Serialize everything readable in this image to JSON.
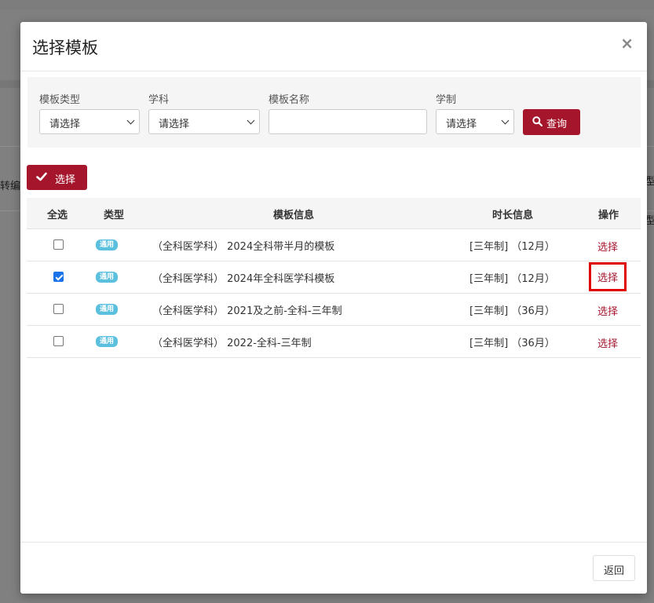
{
  "modal": {
    "title": "选择模板",
    "close_icon": "×"
  },
  "filters": {
    "template_type": {
      "label": "模板类型",
      "value": "请选择"
    },
    "subject": {
      "label": "学科",
      "value": "请选择"
    },
    "template_name": {
      "label": "模板名称",
      "value": ""
    },
    "system": {
      "label": "学制",
      "value": "请选择"
    },
    "query_button": {
      "label": "查询",
      "icon": "search-icon"
    }
  },
  "toolbar": {
    "select_button": {
      "label": "选择",
      "icon": "check-icon"
    }
  },
  "table": {
    "headers": [
      "全选",
      "类型",
      "模板信息",
      "时长信息",
      "操作"
    ],
    "rows": [
      {
        "checked": false,
        "type": "通用",
        "info": "（全科医学科） 2024全科带半月的模板",
        "duration": "[三年制] （12月）",
        "action": "选择"
      },
      {
        "checked": true,
        "type": "通用",
        "info": "（全科医学科） 2024年全科医学科模板",
        "duration": "[三年制] （12月）",
        "action": "选择"
      },
      {
        "checked": false,
        "type": "通用",
        "info": "（全科医学科） 2021及之前-全科-三年制",
        "duration": "[三年制] （36月）",
        "action": "选择"
      },
      {
        "checked": false,
        "type": "通用",
        "info": "（全科医学科） 2022-全科-三年制",
        "duration": "[三年制] （36月）",
        "action": "选择"
      }
    ]
  },
  "footer": {
    "back_button": "返回"
  },
  "background": {
    "left_text": "转编",
    "right_text_1": "型",
    "right_text_2": "型"
  },
  "colors": {
    "primary": "#a5162d",
    "badge": "#5bc0de",
    "checkbox_checked": "#1a73e8",
    "highlight": "#e00000"
  }
}
